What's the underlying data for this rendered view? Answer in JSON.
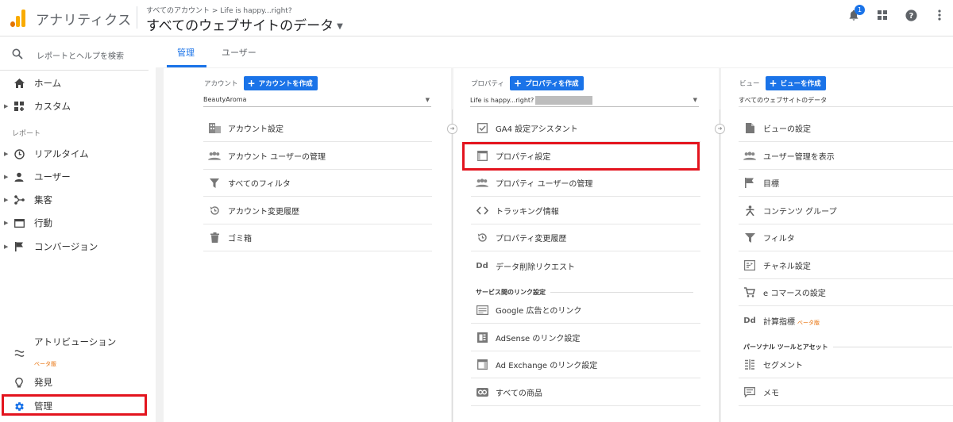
{
  "header": {
    "app_title": "アナリティクス",
    "breadcrumb": "すべてのアカウント > Life is happy...right?",
    "view_title": "すべてのウェブサイトのデータ",
    "notification_count": "1"
  },
  "sidebar": {
    "search_placeholder": "レポートとヘルプを検索",
    "home": "ホーム",
    "custom": "カスタム",
    "reports_section": "レポート",
    "realtime": "リアルタイム",
    "users": "ユーザー",
    "acquisition": "集客",
    "behavior": "行動",
    "conversion": "コンバージョン",
    "attribution": "アトリビューション",
    "attribution_beta": "ベータ版",
    "discover": "発見",
    "admin": "管理"
  },
  "tabs": {
    "admin": "管理",
    "user": "ユーザー"
  },
  "account": {
    "label": "アカウント",
    "create": "アカウントを作成",
    "selected": "BeautyAroma",
    "items": [
      "アカウント設定",
      "アカウント ユーザーの管理",
      "すべてのフィルタ",
      "アカウント変更履歴",
      "ゴミ箱"
    ]
  },
  "property": {
    "label": "プロパティ",
    "create": "プロパティを作成",
    "selected": "Life is happy...right?",
    "items": [
      "GA4 設定アシスタント",
      "プロパティ設定",
      "プロパティ ユーザーの管理",
      "トラッキング情報",
      "プロパティ変更履歴",
      "データ削除リクエスト"
    ],
    "link_section": "サービス間のリンク設定",
    "links": [
      "Google 広告とのリンク",
      "AdSense のリンク設定",
      "Ad Exchange のリンク設定",
      "すべての商品"
    ]
  },
  "view": {
    "label": "ビュー",
    "create": "ビューを作成",
    "selected": "すべてのウェブサイトのデータ",
    "items": [
      "ビューの設定",
      "ユーザー管理を表示",
      "目標",
      "コンテンツ グループ",
      "フィルタ",
      "チャネル設定",
      "e コマースの設定",
      "計算指標"
    ],
    "calc_beta": "ベータ版",
    "personal_section": "パーソナル ツールとアセット",
    "personal": [
      "セグメント",
      "メモ"
    ]
  },
  "colors": {
    "accent": "#1a73e8",
    "highlight": "#e3141e",
    "beta": "#e8710a"
  }
}
